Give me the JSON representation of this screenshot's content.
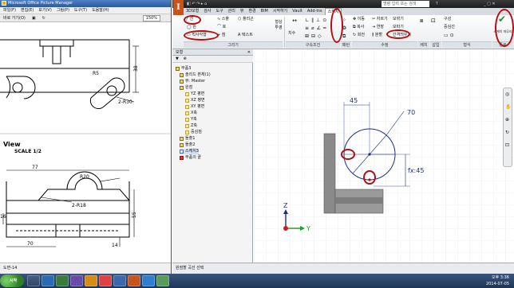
{
  "viewer": {
    "title": "Microsoft Office Picture Manager",
    "menu": [
      "파일(F)",
      "편집(E)",
      "보기(V)",
      "그림(P)",
      "도구(T)",
      "도움말(H)"
    ],
    "toolbar": {
      "shortcut_label": "바로 가기(O)",
      "zoom_value": "150%"
    },
    "drawing": {
      "dim_top_height": "38",
      "dim_r5": "R5",
      "dim_2r30": "2-R30",
      "view_label": "View",
      "scale_label": "SCALE 1/2",
      "dim_77": "77",
      "dim_r20": "R20",
      "dim_2r18": "2-R18",
      "dim_16": "16",
      "dim_55": "55",
      "dim_70": "70",
      "dim_14": "14"
    },
    "status": "도면-14"
  },
  "inventor": {
    "quick_search": "명령 입력 또는 검색",
    "logo_letter": "I",
    "tabs": [
      "3D모형",
      "검사",
      "도구",
      "관리",
      "뷰",
      "환경",
      "BIM",
      "시작하기",
      "Vault",
      "Add-Ins",
      "스케치"
    ],
    "active_tab": "스케치",
    "ribbon": {
      "line": "선",
      "circle": "원",
      "spline": "스플",
      "ellipse_arc": "호",
      "rectangle": "직사각형",
      "polygon_label": "폴리곤",
      "point": "점",
      "text": "텍스트",
      "project_geometry": "형상 투영",
      "dimension": "치수",
      "move": "이동",
      "copy": "복사",
      "rotate": "회전",
      "trim": "자르기",
      "extend": "연장",
      "split": "분할",
      "fillet": "모깎기",
      "chamfer": "모따기",
      "offset": "간격띄우기",
      "construction": "구성",
      "centerline": "중심선",
      "finish_sketch": "스케치 마무리",
      "panel_draw": "그리기",
      "panel_constrain": "구속조건",
      "panel_pattern": "패턴",
      "panel_modify": "수정",
      "panel_layout": "배치",
      "panel_insert": "삽입",
      "panel_format": "형식",
      "panel_exit": "종료"
    },
    "browser": {
      "title": "모형",
      "items": [
        "부품3",
        "솔리드 본체(1)",
        "뷰: Master",
        "원점",
        "YZ 평면",
        "XZ 평면",
        "XY 평면",
        "X축",
        "Y축",
        "Z축",
        "중심점",
        "돌출1",
        "돌출2",
        "스케치3",
        "부품의 끝"
      ],
      "selected": "스케치3"
    },
    "canvas": {
      "dim_45": "45",
      "dim_diameter": "70",
      "dim_fx": "fx:45",
      "axis_z": "Z",
      "axis_y": "Y"
    },
    "status": "원점할 곡선 선택"
  },
  "taskbar": {
    "start": "시작",
    "time": "오후 3:36",
    "date": "2014-07-05"
  },
  "colors": {
    "accent_red": "#b01010",
    "sketch_blue": "#1a2c8c",
    "inventor_orange": "#c8541c"
  }
}
